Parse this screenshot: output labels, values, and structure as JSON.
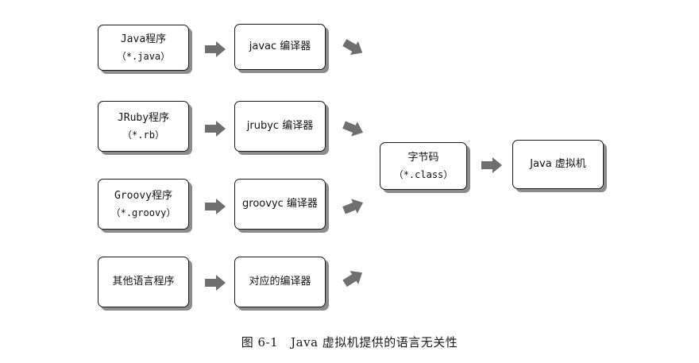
{
  "diagram": {
    "sources": [
      {
        "name": "Java程序",
        "ext": "（*.java）"
      },
      {
        "name": "JRuby程序",
        "ext": "（*.rb）"
      },
      {
        "name": "Groovy程序",
        "ext": "（*.groovy）"
      },
      {
        "name": "其他语言程序",
        "ext": ""
      }
    ],
    "compilers": [
      "javac 编译器",
      "jrubyc 编译器",
      "groovyc 编译器",
      "对应的编译器"
    ],
    "bytecode": {
      "name": "字节码",
      "ext": "（*.class）"
    },
    "jvm": "Java 虚拟机",
    "arrow_color": "#6f6f6f"
  },
  "caption": {
    "number": "图 6-1",
    "text": "Java 虚拟机提供的语言无关性"
  }
}
